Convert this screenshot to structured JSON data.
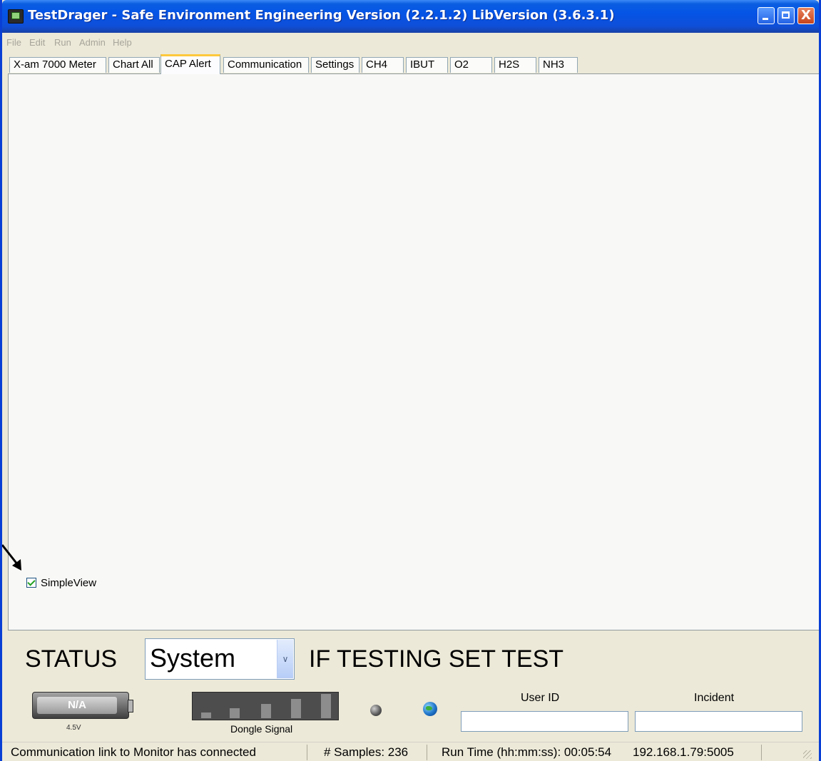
{
  "window": {
    "title": "TestDrager - Safe Environment Engineering Version (2.2.1.2) LibVersion (3.6.3.1)",
    "controls": {
      "minimize": "",
      "maximize": "",
      "close": "X"
    }
  },
  "menu": [
    "File",
    "Edit",
    "Run",
    "Admin",
    "Help"
  ],
  "tabs": [
    "X-am 7000 Meter",
    "Chart All",
    "CAP Alert",
    "Communication",
    "Settings",
    "CH4",
    "IBUT",
    "O2",
    "H2S",
    "NH3"
  ],
  "active_tab": "CAP Alert",
  "simple_view": {
    "label": "SimpleView",
    "checked": true
  },
  "status": {
    "label": "STATUS",
    "select_value": "System",
    "message": "IF TESTING SET TEST"
  },
  "battery": {
    "text": "N/A",
    "voltage": "4.5V"
  },
  "dongle": {
    "label": "Dongle Signal"
  },
  "fields": {
    "user_id_label": "User ID",
    "user_id_value": "",
    "incident_label": "Incident",
    "incident_value": ""
  },
  "statusbar": {
    "message": "Communication link to Monitor has connected",
    "samples": "# Samples: 236",
    "runtime": "Run Time (hh:mm:ss): 00:05:54",
    "address": "192.168.1.79:5005"
  },
  "icons": {
    "app": "app-icon",
    "arrow": "pointer-arrow-icon",
    "led": "status-led-icon",
    "globe": "globe-icon",
    "grip": "resize-grip-icon"
  }
}
